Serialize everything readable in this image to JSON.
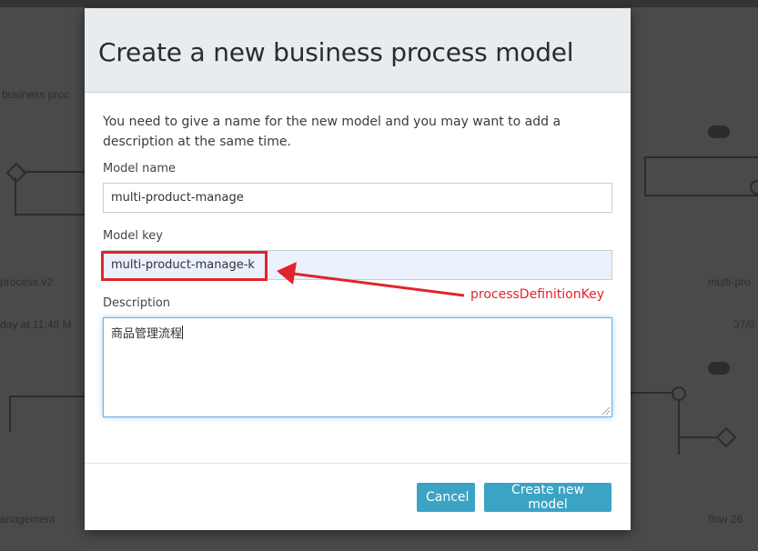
{
  "dialog": {
    "title": "Create a new business process model",
    "intro": "You need to give a name for the new model and you may want to add a description at the same time.",
    "model_name_label": "Model name",
    "model_name_value": "multi-product-manage",
    "model_key_label": "Model key",
    "model_key_value": "multi-product-manage-k",
    "description_label": "Description",
    "description_value": "商品管理流程",
    "cancel_label": "Cancel",
    "create_label": "Create new model"
  },
  "annotation": {
    "text": "processDefinitionKey",
    "color": "#e0242b"
  },
  "background": {
    "texts": [
      "process v2",
      "day at 11:48 M",
      "anagement",
      "business proc",
      "multi-pro",
      "37/0",
      "flow 26"
    ]
  },
  "colors": {
    "primary_button": "#3ba3c4",
    "header_bg": "#e8ecef",
    "focus_border": "#66afe9"
  }
}
